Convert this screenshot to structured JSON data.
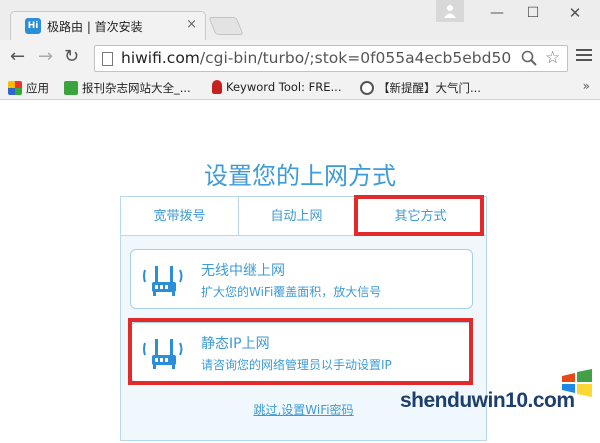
{
  "browser": {
    "tab_title": "极路由 | 首次安装",
    "favicon_text": "Hi",
    "url_host": "hiwifi.com",
    "url_path": "/cgi-bin/turbo/;stok=0f055a4ecb5ebd50ec8",
    "bookmarks": [
      {
        "label": "应用",
        "icon": "apps-icon"
      },
      {
        "label": "报刊杂志网站大全_...",
        "icon": "green-c-icon"
      },
      {
        "label": "Keyword Tool: FRE...",
        "icon": "flame-icon"
      },
      {
        "label": "【新提醒】大气门...",
        "icon": "wordpress-icon"
      }
    ],
    "bookmarks_more": "»"
  },
  "page": {
    "title": "设置您的上网方式",
    "tabs": [
      {
        "label": "宽带拨号"
      },
      {
        "label": "自动上网"
      },
      {
        "label": "其它方式"
      }
    ],
    "options": [
      {
        "title": "无线中继上网",
        "desc": "扩大您的WiFi覆盖面积，放大信号",
        "icon": "router-icon"
      },
      {
        "title": "静态IP上网",
        "desc": "请咨询您的网络管理员以手动设置IP",
        "icon": "router-icon"
      }
    ],
    "skip_link": "跳过,设置WiFi密码",
    "highlight_color": "#e32a2a",
    "accent_color": "#3d9bd6"
  },
  "watermark": {
    "text": "shenduwin10.com"
  }
}
